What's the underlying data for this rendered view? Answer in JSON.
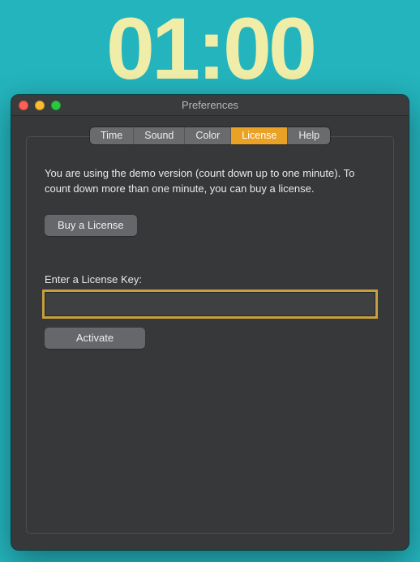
{
  "timer": {
    "display": "01:00"
  },
  "window": {
    "title": "Preferences",
    "tabs": [
      {
        "label": "Time"
      },
      {
        "label": "Sound"
      },
      {
        "label": "Color"
      },
      {
        "label": "License"
      },
      {
        "label": "Help"
      }
    ],
    "active_tab": "License",
    "license_pane": {
      "demo_text": "You are using the demo version (count down up to one minute). To count down more than one minute, you can buy a license.",
      "buy_button": "Buy a License",
      "enter_label": "Enter a License Key:",
      "key_value": "",
      "activate_button": "Activate"
    }
  }
}
